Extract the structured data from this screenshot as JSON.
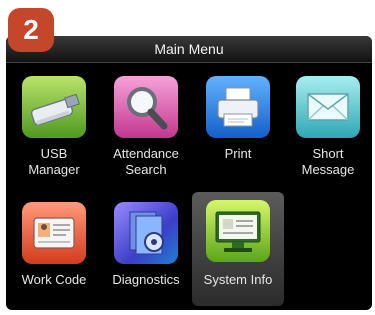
{
  "step_badge": "2",
  "title": "Main Menu",
  "menu_items": [
    {
      "label": "USB\nManager",
      "icon": "usb-drive-icon"
    },
    {
      "label": "Attendance\nSearch",
      "icon": "magnifier-icon"
    },
    {
      "label": "Print",
      "icon": "printer-icon"
    },
    {
      "label": "Short\nMessage",
      "icon": "envelope-icon"
    },
    {
      "label": "Work Code",
      "icon": "id-card-icon"
    },
    {
      "label": "Diagnostics",
      "icon": "diagnostics-icon"
    },
    {
      "label": "System Info",
      "icon": "system-info-icon",
      "selected": true
    }
  ]
}
